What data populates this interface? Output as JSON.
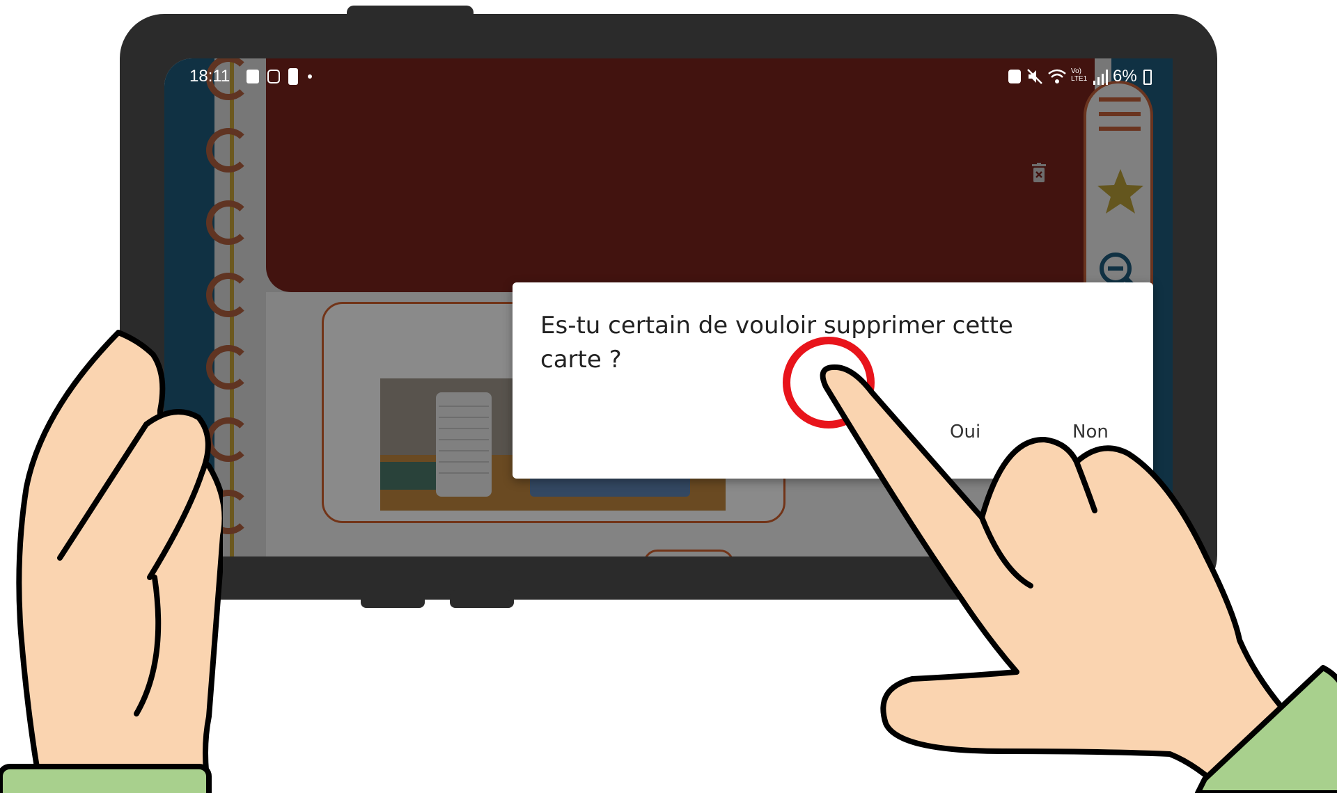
{
  "status_bar": {
    "time": "18:11",
    "battery": "6%",
    "network_label": "Vo) LTE1"
  },
  "dialog": {
    "message": "Es-tu certain de vouloir supprimer cette carte ?",
    "confirm_label": "Oui",
    "cancel_label": "Non"
  },
  "icons": {
    "menu": "menu-icon",
    "favorite": "star-icon",
    "zoom": "zoom-out-icon",
    "exit": "exit-arrow-icon",
    "delete": "trash-icon"
  },
  "colors": {
    "header": "#7a231c",
    "accent": "#d2612d",
    "sidebar": "#1f5b7d",
    "tap_highlight": "#e8141b",
    "sleeve": "#a8d08d",
    "skin": "#fad4b0",
    "tablet": "#2b2b2b"
  }
}
